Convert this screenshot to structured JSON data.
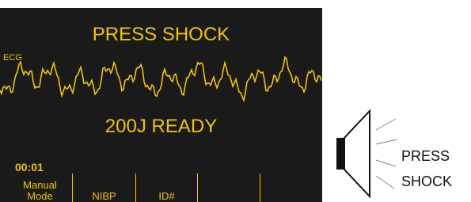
{
  "monitor": {
    "prompt_top": "PRESS SHOCK",
    "ecg_label": "ECG",
    "prompt_mid": "200J READY",
    "timer": "00:01",
    "softkeys": [
      {
        "line1": "Manual",
        "line2": "Mode"
      },
      {
        "line1": "",
        "line2": "NIBP"
      },
      {
        "line1": "",
        "line2": "ID#"
      },
      {
        "line1": "",
        "line2": ""
      },
      {
        "line1": "",
        "line2": ""
      }
    ],
    "colors": {
      "background": "#1a1a1a",
      "text": "#f0c400"
    }
  },
  "voice_prompt": {
    "icon": "speaker-icon",
    "line1": "PRESS",
    "line2": "SHOCK"
  }
}
